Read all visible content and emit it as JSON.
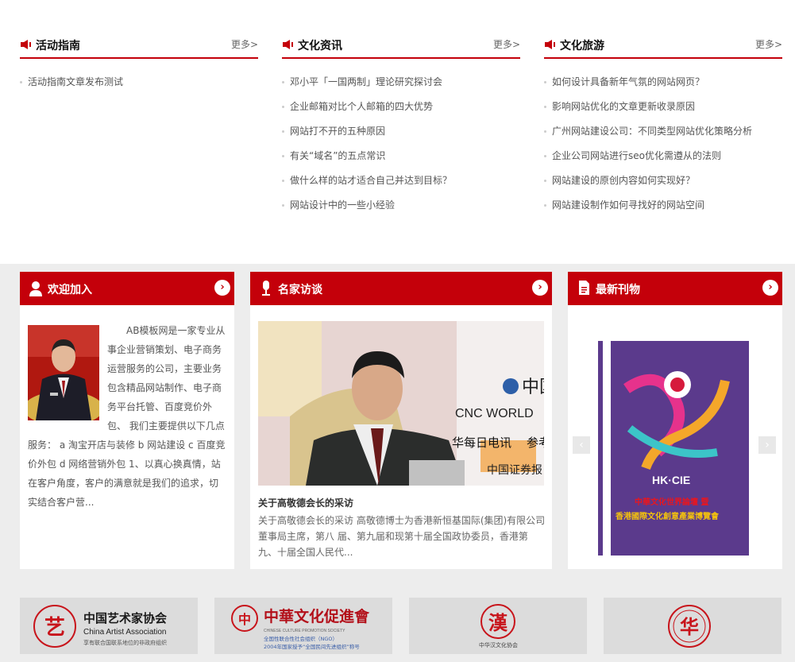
{
  "news_columns": [
    {
      "title": "活动指南",
      "more": "更多>",
      "items": [
        "活动指南文章发布测试"
      ]
    },
    {
      "title": "文化资讯",
      "more": "更多>",
      "items": [
        "邓小平「一国两制」理论研究探讨会",
        "企业邮箱对比个人邮箱的四大优势",
        "网站打不开的五种原因",
        "有关“域名”的五点常识",
        "做什么样的站才适合自己并达到目标？",
        "网站设计中的一些小经验"
      ]
    },
    {
      "title": "文化旅游",
      "more": "更多>",
      "items": [
        "如何设计具备新年气氛的网站网页？",
        "影响网站优化的文章更新收录原因",
        "广州网站建设公司：不同类型网站优化策略分析",
        "企业公司网站进行seo优化需遵从的法则",
        "网站建设的原创内容如何实现好？",
        "网站建设制作如何寻找好的网站空间"
      ]
    }
  ],
  "welcome": {
    "title": "欢迎加入",
    "arrow": "›",
    "text": "AB模板网是一家专业从事企业营销策划、电子商务运营服务的公司，主要业务包含精品网站制作、电子商务平台托管、百度竞价外包、 我们主要提供以下几点服务： a 淘宝开店与装修 b 网站建设 c 百度竞价外包 d 网络营销外包 1、以真心换真情，站在客户角度，客户的满意就是我们的追求，切实结合客户营..."
  },
  "interview": {
    "title": "名家访谈",
    "arrow": "›",
    "article_title": "关于高敬德会长的采访",
    "article_desc": "关于高敬德会长的采访 高敬德博士为香港新恒基国际(集团)有限公司董事局主席，第八 届、第九届和现第十届全国政协委员，香港第九、十届全国人民代...",
    "backdrop_text": [
      "CNC WORLD",
      "华每日电讯",
      "参考",
      "中国证券报",
      "中国"
    ]
  },
  "publication": {
    "title": "最新刊物",
    "arrow": "›",
    "prev": "‹",
    "next": "›",
    "cover_brand": "HK·CIE",
    "cover_line1": "中華文化世界論壇 暨",
    "cover_line2": "香港國際文化創意產業博覽會"
  },
  "logos": [
    {
      "name_cn": "中国艺术家协会",
      "name_en": "China Artist Association",
      "sub": "享有联合国联系地位的非政府组织",
      "seal_char": "艺"
    },
    {
      "name_cn": "中華文化促進會",
      "name_en": "CHINESE CULTURE PROMOTION SOCIETY",
      "sub1": "全国性联合性社会组织（NGO）",
      "sub2": "2004年国家授予“全国民间先进组织”称号",
      "seal_char": "中"
    },
    {
      "seal_char": "漢",
      "sub": "中华汉文化协会"
    },
    {
      "seal_char": "华"
    }
  ],
  "colors": {
    "accent": "#c4000a",
    "band_bg": "#ededed",
    "cover_purple": "#5b3a8c"
  }
}
